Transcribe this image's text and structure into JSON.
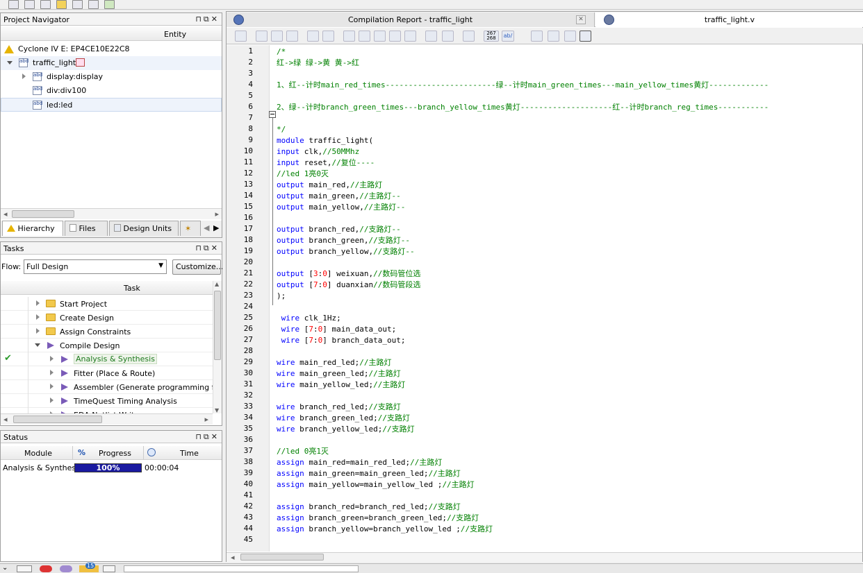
{
  "project_navigator": {
    "title": "Project Navigator",
    "column_header": "Entity",
    "device": "Cyclone IV E: EP4CE10E22C8",
    "top_entity": "traffic_light",
    "children": [
      "display:display",
      "div:div100",
      "led:led"
    ],
    "tabs": [
      "Hierarchy",
      "Files",
      "Design Units"
    ]
  },
  "tasks": {
    "title": "Tasks",
    "flow_label": "Flow:",
    "flow_value": "Full Design",
    "customize_label": "Customize...",
    "column_header": "Task",
    "items": [
      {
        "label": "Start Project",
        "type": "folder"
      },
      {
        "label": "Create Design",
        "type": "folder"
      },
      {
        "label": "Assign Constraints",
        "type": "folder"
      },
      {
        "label": "Compile Design",
        "type": "play"
      },
      {
        "label": "Analysis & Synthesis",
        "type": "play",
        "status": "done"
      },
      {
        "label": "Fitter (Place & Route)",
        "type": "play"
      },
      {
        "label": "Assembler (Generate programming files)",
        "type": "play"
      },
      {
        "label": "TimeQuest Timing Analysis",
        "type": "play"
      },
      {
        "label": "EDA Netlist Writer",
        "type": "play"
      }
    ]
  },
  "status": {
    "title": "Status",
    "headers": {
      "module": "Module",
      "percent": "%",
      "progress": "Progress",
      "time": "Time"
    },
    "row": {
      "module": "Analysis & Synthesis",
      "progress": "100%",
      "progress_value": 100,
      "time": "00:00:04"
    }
  },
  "editor": {
    "tabs": [
      "Compilation Report - traffic_light",
      "traffic_light.v"
    ],
    "active_tab": 1,
    "lines": [
      [
        [
          "cm",
          "/*"
        ]
      ],
      [
        [
          "cm",
          "红->绿 绿->黄 黄->红"
        ]
      ],
      [],
      [
        [
          "cm",
          "1、红--计时main_red_times------------------------绿--计时main_green_times---main_yellow_times黄灯-------------"
        ]
      ],
      [],
      [
        [
          "cm",
          "2、绿--计时branch_green_times---branch_yellow_times黄灯--------------------红--计时branch_reg_times-----------"
        ]
      ],
      [],
      [
        [
          "cm",
          "*/"
        ]
      ],
      [
        [
          "kw",
          "module"
        ],
        [
          "tx",
          " traffic_light("
        ]
      ],
      [
        [
          "kw",
          "input"
        ],
        [
          "tx",
          " clk,"
        ],
        [
          "cm",
          "//50MMhz"
        ]
      ],
      [
        [
          "kw",
          "input"
        ],
        [
          "tx",
          " reset,"
        ],
        [
          "cm",
          "//复位----"
        ]
      ],
      [
        [
          "cm",
          "//led 1亮0灭"
        ]
      ],
      [
        [
          "kw",
          "output"
        ],
        [
          "tx",
          " main_red,"
        ],
        [
          "cm",
          "//主路灯"
        ]
      ],
      [
        [
          "kw",
          "output"
        ],
        [
          "tx",
          " main_green,"
        ],
        [
          "cm",
          "//主路灯--"
        ]
      ],
      [
        [
          "kw",
          "output"
        ],
        [
          "tx",
          " main_yellow,"
        ],
        [
          "cm",
          "//主路灯--"
        ]
      ],
      [],
      [
        [
          "kw",
          "output"
        ],
        [
          "tx",
          " branch_red,"
        ],
        [
          "cm",
          "//支路灯--"
        ]
      ],
      [
        [
          "kw",
          "output"
        ],
        [
          "tx",
          " branch_green,"
        ],
        [
          "cm",
          "//支路灯--"
        ]
      ],
      [
        [
          "kw",
          "output"
        ],
        [
          "tx",
          " branch_yellow,"
        ],
        [
          "cm",
          "//支路灯--"
        ]
      ],
      [],
      [
        [
          "kw",
          "output"
        ],
        [
          "tx",
          " ["
        ],
        [
          "nm",
          "3"
        ],
        [
          "tx",
          ":"
        ],
        [
          "nm",
          "0"
        ],
        [
          "tx",
          "] weixuan,"
        ],
        [
          "cm",
          "//数码管位选"
        ]
      ],
      [
        [
          "kw",
          "output"
        ],
        [
          "tx",
          " ["
        ],
        [
          "nm",
          "7"
        ],
        [
          "tx",
          ":"
        ],
        [
          "nm",
          "0"
        ],
        [
          "tx",
          "] duanxian"
        ],
        [
          "cm",
          "//数码管段选"
        ]
      ],
      [
        [
          "tx",
          ");"
        ]
      ],
      [],
      [
        [
          "tx",
          " "
        ],
        [
          "kw",
          "wire"
        ],
        [
          "tx",
          " clk_1Hz;"
        ]
      ],
      [
        [
          "tx",
          " "
        ],
        [
          "kw",
          "wire"
        ],
        [
          "tx",
          " ["
        ],
        [
          "nm",
          "7"
        ],
        [
          "tx",
          ":"
        ],
        [
          "nm",
          "0"
        ],
        [
          "tx",
          "] main_data_out;"
        ]
      ],
      [
        [
          "tx",
          " "
        ],
        [
          "kw",
          "wire"
        ],
        [
          "tx",
          " ["
        ],
        [
          "nm",
          "7"
        ],
        [
          "tx",
          ":"
        ],
        [
          "nm",
          "0"
        ],
        [
          "tx",
          "] branch_data_out;"
        ]
      ],
      [],
      [
        [
          "kw",
          "wire"
        ],
        [
          "tx",
          " main_red_led;"
        ],
        [
          "cm",
          "//主路灯"
        ]
      ],
      [
        [
          "kw",
          "wire"
        ],
        [
          "tx",
          " main_green_led;"
        ],
        [
          "cm",
          "//主路灯"
        ]
      ],
      [
        [
          "kw",
          "wire"
        ],
        [
          "tx",
          " main_yellow_led;"
        ],
        [
          "cm",
          "//主路灯"
        ]
      ],
      [],
      [
        [
          "kw",
          "wire"
        ],
        [
          "tx",
          " branch_red_led;"
        ],
        [
          "cm",
          "//支路灯"
        ]
      ],
      [
        [
          "kw",
          "wire"
        ],
        [
          "tx",
          " branch_green_led;"
        ],
        [
          "cm",
          "//支路灯"
        ]
      ],
      [
        [
          "kw",
          "wire"
        ],
        [
          "tx",
          " branch_yellow_led;"
        ],
        [
          "cm",
          "//支路灯"
        ]
      ],
      [],
      [
        [
          "cm",
          "//led 0亮1灭"
        ]
      ],
      [
        [
          "kw",
          "assign"
        ],
        [
          "tx",
          " main_red=main_red_led;"
        ],
        [
          "cm",
          "//主路灯"
        ]
      ],
      [
        [
          "kw",
          "assign"
        ],
        [
          "tx",
          " main_green=main_green_led;"
        ],
        [
          "cm",
          "//主路灯"
        ]
      ],
      [
        [
          "kw",
          "assign"
        ],
        [
          "tx",
          " main_yellow=main_yellow_led ;"
        ],
        [
          "cm",
          "//主路灯"
        ]
      ],
      [],
      [
        [
          "kw",
          "assign"
        ],
        [
          "tx",
          " branch_red=branch_red_led;"
        ],
        [
          "cm",
          "//支路灯"
        ]
      ],
      [
        [
          "kw",
          "assign"
        ],
        [
          "tx",
          " branch_green=branch_green_led;"
        ],
        [
          "cm",
          "//支路灯"
        ]
      ],
      [
        [
          "kw",
          "assign"
        ],
        [
          "tx",
          " branch_yellow=branch_yellow_led ;"
        ],
        [
          "cm",
          "//支路灯"
        ]
      ],
      []
    ]
  },
  "bottom": {
    "badge_count": "15"
  }
}
